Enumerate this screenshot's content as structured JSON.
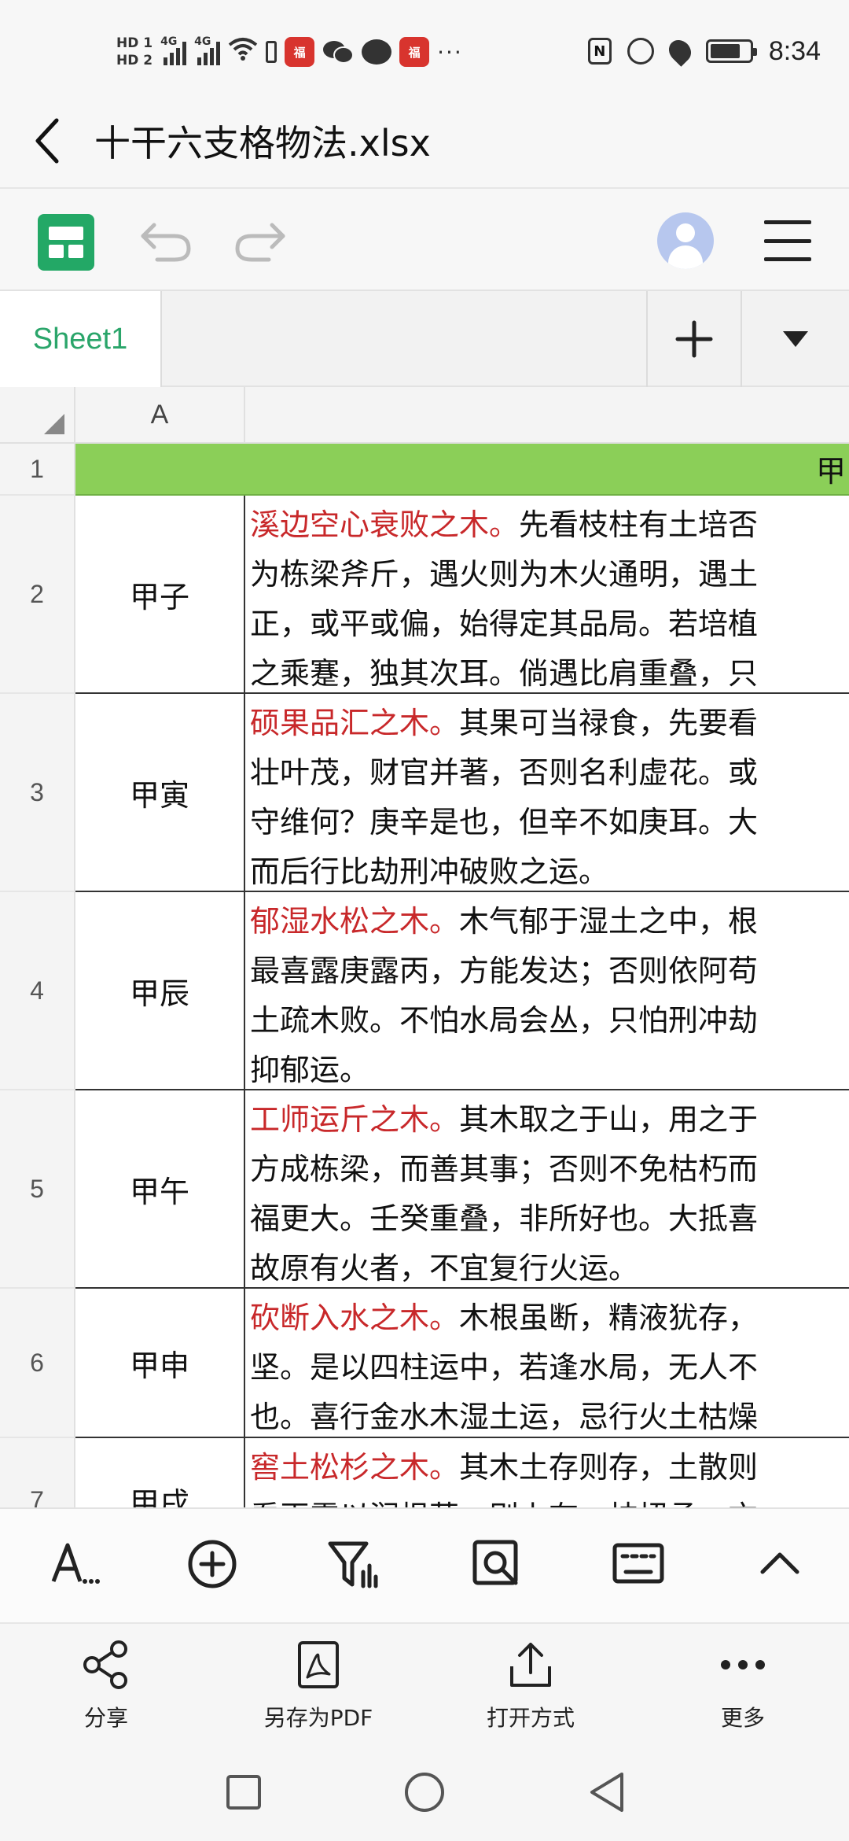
{
  "status_bar": {
    "hd1": "HD 1",
    "hd2": "HD 2",
    "network1": "4G",
    "network2": "4G",
    "app_badge": "福",
    "more": "···",
    "nfc": "N",
    "time": "8:34",
    "battery_level": 0.78
  },
  "header": {
    "title": "十干六支格物法.xlsx"
  },
  "toolbar": {
    "icons": [
      "sheets-logo-icon",
      "undo-icon",
      "redo-icon",
      "avatar",
      "menu-icon"
    ]
  },
  "tabs": {
    "sheet1": "Sheet1",
    "add": "+",
    "more": "▼"
  },
  "grid": {
    "column_headers": [
      "A"
    ],
    "header_row": {
      "row": "1",
      "text": "甲"
    },
    "rows": [
      {
        "row": "2",
        "a": "甲子",
        "b_red": "溪边空心衰败之木。",
        "b_lines": [
          "先看枝柱有土培否",
          "为栋梁斧斤，遇火则为木火通明，遇土",
          "正，或平或偏，始得定其品局。若培植",
          "之乘蹇，独其次耳。倘遇比肩重叠，只"
        ]
      },
      {
        "row": "3",
        "a": "甲寅",
        "b_red": "硕果品汇之木。",
        "b_lines": [
          "其果可当禄食，先要看",
          "壮叶茂，财官并著，否则名利虚花。或",
          "守维何？庚辛是也，但辛不如庚耳。大",
          "而后行比劫刑冲破败之运。"
        ]
      },
      {
        "row": "4",
        "a": "甲辰",
        "b_red": "郁湿水松之木。",
        "b_lines": [
          "木气郁于湿土之中，根",
          "最喜露庚露丙，方能发达；否则依阿苟",
          "土疏木败。不怕水局会丛，只怕刑冲劫",
          "抑郁运。"
        ]
      },
      {
        "row": "5",
        "a": "甲午",
        "b_red": "工师运斤之木。",
        "b_lines": [
          "其木取之于山，用之于",
          "方成栋梁，而善其事；否则不免枯朽而",
          "福更大。壬癸重叠，非所好也。大抵喜",
          "故原有火者，不宜复行火运。"
        ]
      },
      {
        "row": "6",
        "a": "甲申",
        "b_red": "砍断入水之木。",
        "b_lines": [
          "木根虽断，精液犹存，",
          "坚。是以四柱运中，若逢水局，无人不",
          "也。喜行金水木湿土运，忌行火土枯燥"
        ]
      },
      {
        "row": "7",
        "a": "甲戌",
        "b_red": "窖土松杉之木。",
        "b_lines": [
          "其木土存则存，土散则",
          "看再露以润根茎，则上有，枝扭承，亦"
        ]
      }
    ]
  },
  "bottom_toolbar": {
    "icons": [
      "font-format-icon",
      "insert-icon",
      "filter-icon",
      "find-icon",
      "keyboard-icon",
      "collapse-icon"
    ]
  },
  "share_bar": {
    "share": "分享",
    "save_pdf": "另存为PDF",
    "open_with": "打开方式",
    "more": "更多"
  }
}
